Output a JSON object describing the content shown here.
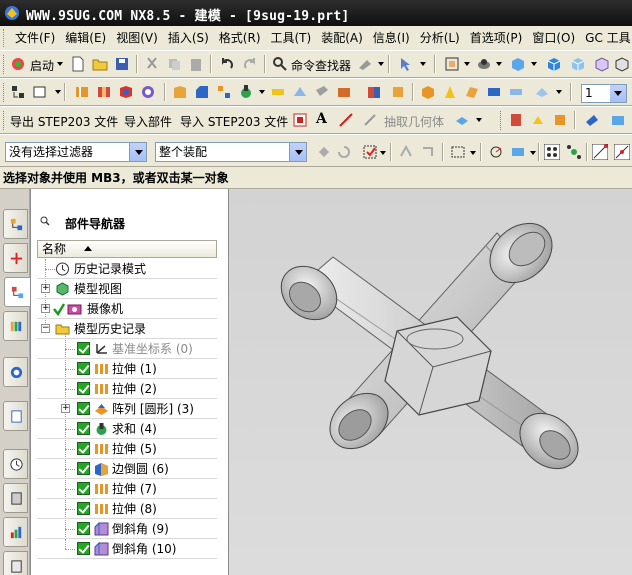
{
  "window": {
    "title": "WWW.9SUG.COM NX8.5 - 建模 - [9sug-19.prt]"
  },
  "menu": [
    "文件(F)",
    "编辑(E)",
    "视图(V)",
    "插入(S)",
    "格式(R)",
    "工具(T)",
    "装配(A)",
    "信息(I)",
    "分析(L)",
    "首选项(P)",
    "窗口(O)",
    "GC 工具"
  ],
  "toolbar1": {
    "start_label": "启动",
    "command_finder_label": "命令查找器"
  },
  "toolbar2": {
    "number_value": "1"
  },
  "toolbar3": {
    "export_step_label": "导出 STEP203 文件",
    "import_part_label": "导入部件",
    "import_step_label": "导入 STEP203 文件",
    "text_tool_label": "A",
    "extract_geometry_label": "抽取几何体"
  },
  "selection_bar": {
    "filter_value": "没有选择过滤器",
    "scope_value": "整个装配"
  },
  "status": {
    "cue_text": "选择对象并使用 MB3，或者双击某一对象"
  },
  "navigator": {
    "title": "部件导航器",
    "column_header": "名称",
    "rows": [
      {
        "label": "历史记录模式",
        "icon": "clock-icon"
      },
      {
        "label": "模型视图",
        "icon": "model-views-icon"
      },
      {
        "label": "摄像机",
        "icon": "camera-icon"
      },
      {
        "label": "模型历史记录",
        "icon": "folder-icon"
      },
      {
        "label": "基准坐标系 (0)",
        "icon": "datum-csys-icon"
      },
      {
        "label": "拉伸 (1)",
        "icon": "extrude-icon"
      },
      {
        "label": "拉伸 (2)",
        "icon": "extrude-icon"
      },
      {
        "label": "阵列 [圆形] (3)",
        "icon": "pattern-icon"
      },
      {
        "label": "求和 (4)",
        "icon": "unite-icon"
      },
      {
        "label": "拉伸 (5)",
        "icon": "extrude-icon"
      },
      {
        "label": "边倒圆 (6)",
        "icon": "edge-blend-icon"
      },
      {
        "label": "拉伸 (7)",
        "icon": "extrude-icon"
      },
      {
        "label": "拉伸 (8)",
        "icon": "extrude-icon"
      },
      {
        "label": "倒斜角 (9)",
        "icon": "chamfer-icon"
      },
      {
        "label": "倒斜角 (10)",
        "icon": "chamfer-icon"
      }
    ]
  },
  "colors": {
    "titlebar": "#1a1a1a",
    "toolbar_bg": "#ece9d8",
    "checkbox_green": "#24a524",
    "viewport_bg": "#d6d6d6"
  }
}
